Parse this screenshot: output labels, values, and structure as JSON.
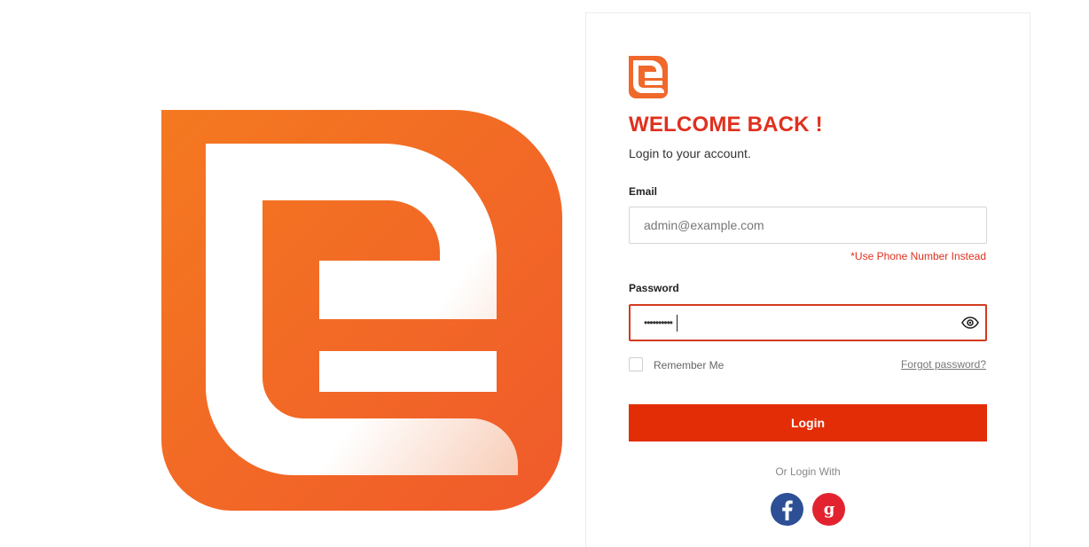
{
  "brand": {
    "primary_color": "#f0682a",
    "accent_red": "#e32d06"
  },
  "login": {
    "title": "WELCOME BACK !",
    "subtitle": "Login to your account.",
    "email": {
      "label": "Email",
      "placeholder": "admin@example.com",
      "value": "",
      "hint": "*Use Phone Number Instead"
    },
    "password": {
      "label": "Password",
      "value": "••••••••••",
      "toggle_icon": "eye-icon"
    },
    "remember_label": "Remember Me",
    "remember_checked": false,
    "forgot_label": "Forgot password?",
    "submit_label": "Login",
    "or_login_with": "Or Login With",
    "social": [
      {
        "name": "facebook",
        "icon": "facebook-icon",
        "glyph": "f",
        "color": "#2d4f95"
      },
      {
        "name": "google",
        "icon": "google-icon",
        "glyph": "g",
        "color": "#e2232f"
      }
    ]
  }
}
